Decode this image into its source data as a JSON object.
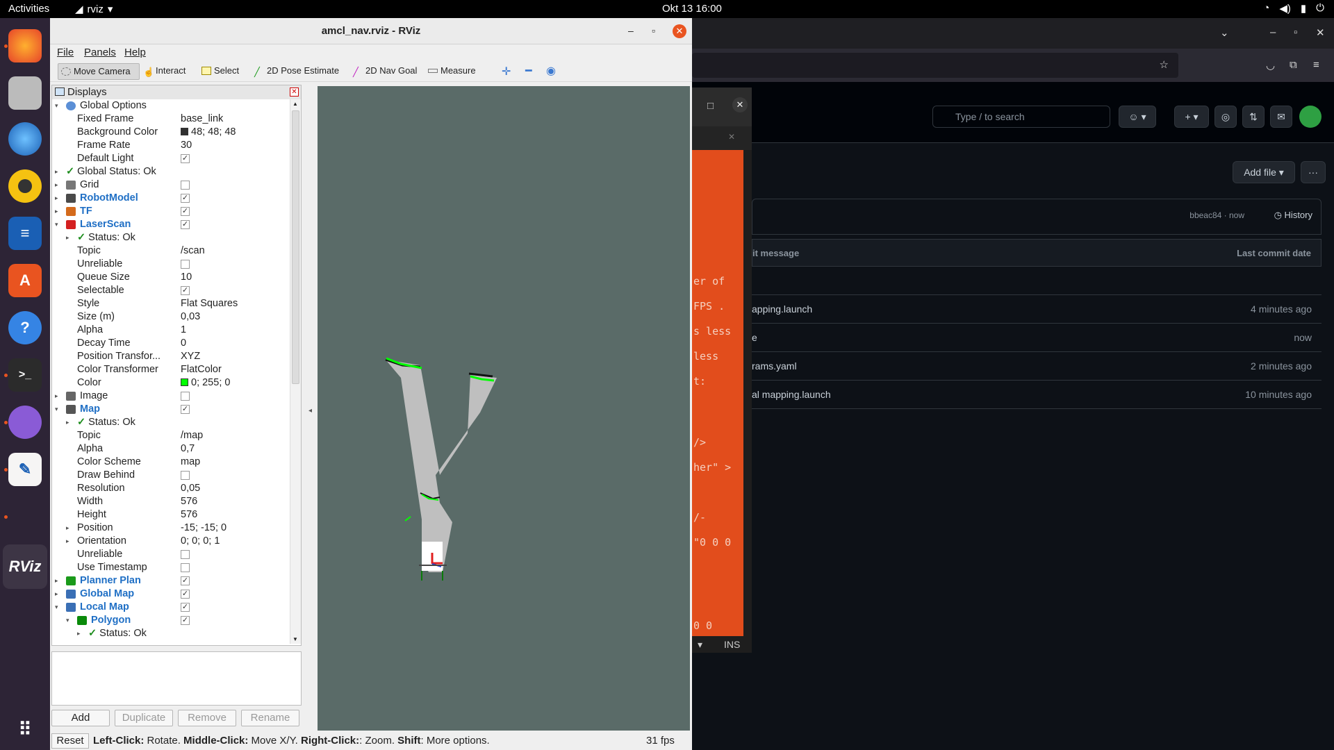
{
  "topbar": {
    "activities": "Activities",
    "app_name": "rviz",
    "clock": "Okt 13  16:00"
  },
  "dock": {
    "items": [
      "firefox-icon",
      "files-icon",
      "thunderbird-icon",
      "rhythmbox-icon",
      "writer-icon",
      "software-icon",
      "help-icon",
      "terminal-icon",
      "network-icon",
      "text-editor-icon",
      "rviz-icon",
      "apps-grid-icon"
    ],
    "rviz_label": "RViz"
  },
  "window": {
    "title": "amcl_nav.rviz - RViz"
  },
  "menu": {
    "file": "File",
    "panels": "Panels",
    "help": "Help"
  },
  "toolbar": {
    "move_camera": "Move Camera",
    "interact": "Interact",
    "select": "Select",
    "pose_estimate": "2D Pose Estimate",
    "nav_goal": "2D Nav Goal",
    "measure": "Measure"
  },
  "displays": {
    "title": "Displays",
    "rows": [
      {
        "label": "Global Options",
        "value": "",
        "indent": 1,
        "arrow": "▾",
        "icon": "gear-icon",
        "style": "normal"
      },
      {
        "label": "Fixed Frame",
        "value": "base_link",
        "indent": 2
      },
      {
        "label": "Background Color",
        "value": "48; 48; 48",
        "indent": 2,
        "swatch": "#303030"
      },
      {
        "label": "Frame Rate",
        "value": "30",
        "indent": 2
      },
      {
        "label": "Default Light",
        "value": "",
        "indent": 2,
        "check": "✓"
      },
      {
        "label": "Global Status: Ok",
        "value": "",
        "indent": 1,
        "arrow": "▸",
        "ok": true
      },
      {
        "label": "Grid",
        "value": "",
        "indent": 1,
        "arrow": "▸",
        "icon": "grid-icon",
        "check": ""
      },
      {
        "label": "RobotModel",
        "value": "",
        "indent": 1,
        "arrow": "▸",
        "icon": "robot-icon",
        "check": "✓",
        "blue": true
      },
      {
        "label": "TF",
        "value": "",
        "indent": 1,
        "arrow": "▸",
        "icon": "tf-icon",
        "check": "✓",
        "blue": true
      },
      {
        "label": "LaserScan",
        "value": "",
        "indent": 1,
        "arrow": "▾",
        "icon": "laserscan-icon",
        "check": "✓",
        "blue": true
      },
      {
        "label": "Status: Ok",
        "value": "",
        "indent": 2,
        "arrow": "▸",
        "ok": true
      },
      {
        "label": "Topic",
        "value": "/scan",
        "indent": 2
      },
      {
        "label": "Unreliable",
        "value": "",
        "indent": 2,
        "check": ""
      },
      {
        "label": "Queue Size",
        "value": "10",
        "indent": 2
      },
      {
        "label": "Selectable",
        "value": "",
        "indent": 2,
        "check": "✓"
      },
      {
        "label": "Style",
        "value": "Flat Squares",
        "indent": 2
      },
      {
        "label": "Size (m)",
        "value": "0,03",
        "indent": 2
      },
      {
        "label": "Alpha",
        "value": "1",
        "indent": 2
      },
      {
        "label": "Decay Time",
        "value": "0",
        "indent": 2
      },
      {
        "label": "Position Transfor...",
        "value": "XYZ",
        "indent": 2
      },
      {
        "label": "Color Transformer",
        "value": "FlatColor",
        "indent": 2
      },
      {
        "label": "Color",
        "value": "0; 255; 0",
        "indent": 2,
        "swatch": "#00ff00"
      },
      {
        "label": "Image",
        "value": "",
        "indent": 1,
        "arrow": "▸",
        "icon": "image-icon",
        "check": ""
      },
      {
        "label": "Map",
        "value": "",
        "indent": 1,
        "arrow": "▾",
        "icon": "map-icon",
        "check": "✓",
        "blue": true
      },
      {
        "label": "Status: Ok",
        "value": "",
        "indent": 2,
        "arrow": "▸",
        "ok": true
      },
      {
        "label": "Topic",
        "value": "/map",
        "indent": 2
      },
      {
        "label": "Alpha",
        "value": "0,7",
        "indent": 2
      },
      {
        "label": "Color Scheme",
        "value": "map",
        "indent": 2
      },
      {
        "label": "Draw Behind",
        "value": "",
        "indent": 2,
        "check": ""
      },
      {
        "label": "Resolution",
        "value": "0,05",
        "indent": 2
      },
      {
        "label": "Width",
        "value": "576",
        "indent": 2
      },
      {
        "label": "Height",
        "value": "576",
        "indent": 2
      },
      {
        "label": "Position",
        "value": "-15; -15; 0",
        "indent": 2,
        "arrow": "▸"
      },
      {
        "label": "Orientation",
        "value": "0; 0; 0; 1",
        "indent": 2,
        "arrow": "▸"
      },
      {
        "label": "Unreliable",
        "value": "",
        "indent": 2,
        "check": ""
      },
      {
        "label": "Use Timestamp",
        "value": "",
        "indent": 2,
        "check": ""
      },
      {
        "label": "Planner Plan",
        "value": "",
        "indent": 1,
        "arrow": "▸",
        "icon": "path-icon",
        "check": "✓",
        "blue": true
      },
      {
        "label": "Global Map",
        "value": "",
        "indent": 1,
        "arrow": "▸",
        "icon": "folder-icon",
        "check": "✓",
        "blue": true
      },
      {
        "label": "Local Map",
        "value": "",
        "indent": 1,
        "arrow": "▾",
        "icon": "folder-icon",
        "check": "✓",
        "blue": true
      },
      {
        "label": "Polygon",
        "value": "",
        "indent": 2,
        "arrow": "▾",
        "icon": "polygon-icon",
        "check": "✓",
        "blue": true
      },
      {
        "label": "Status: Ok",
        "value": "",
        "indent": 3,
        "arrow": "▸",
        "ok": true
      }
    ]
  },
  "buttons": {
    "add": "Add",
    "duplicate": "Duplicate",
    "remove": "Remove",
    "rename": "Rename"
  },
  "status": {
    "reset": "Reset",
    "hint_left_key": "Left-Click:",
    "hint_left": " Rotate. ",
    "hint_mid_key": "Middle-Click:",
    "hint_mid": " Move X/Y. ",
    "hint_right_key": "Right-Click:",
    "hint_right": ": Zoom. ",
    "hint_shift_key": "Shift",
    "hint_shift": ": More options.",
    "fps": "31 fps"
  },
  "terminal": {
    "lines": [
      "er of",
      "FPS .",
      "s less",
      " less",
      "t:",
      "/>",
      "her\" >",
      "/-",
      "\"0 0 0",
      "0 0"
    ],
    "mode": "INS"
  },
  "github": {
    "search_placeholder": "Type / to search",
    "add_file": "Add file",
    "commit_author": "bbeac84 · now",
    "history": "History",
    "col_message": "it message",
    "col_date": "Last commit date",
    "rows": [
      {
        "name": "apping.launch",
        "date": "4 minutes ago"
      },
      {
        "name": "e",
        "date": "now"
      },
      {
        "name": "rams.yaml",
        "date": "2 minutes ago"
      },
      {
        "name": "al mapping.launch",
        "date": "10 minutes ago"
      }
    ]
  },
  "colors": {
    "accent": "#e95420",
    "view_bg": "#5a6b68",
    "laser": "#00ff00",
    "link_blue": "#1f6fc5"
  }
}
